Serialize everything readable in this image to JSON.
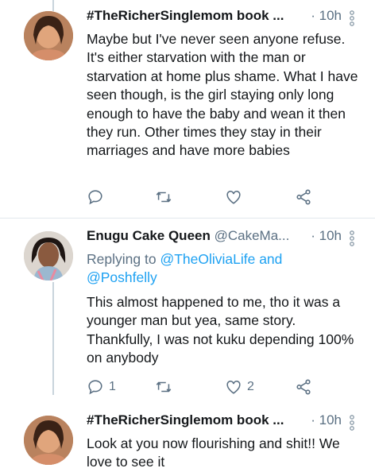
{
  "tweets": [
    {
      "name": "#TheRicherSinglemom book ...",
      "handle": "",
      "time": "· 10h",
      "replying_prefix": "",
      "replying_link1": "",
      "replying_and": "",
      "replying_link2": "",
      "body": "Maybe but I've never seen anyone refuse. It's either starvation with the man or starvation at home plus shame. What I have seen though, is the girl staying only long enough to have the baby and wean it then they run. Other times they stay in their marriages and have more babies",
      "reply_count": "",
      "retweet_count": "",
      "like_count": ""
    },
    {
      "name": "Enugu Cake Queen",
      "handle": "@CakeMa...",
      "time": "· 10h",
      "replying_prefix": "Replying to",
      "replying_link1": "@TheOliviaLife and",
      "replying_link2": "@Poshfelly",
      "body": "This almost happened to me, tho it was a younger man but yea, same story. Thankfully, I was not kuku depending 100% on anybody",
      "reply_count": "1",
      "retweet_count": "",
      "like_count": "2"
    },
    {
      "name": "#TheRicherSinglemom book ...",
      "handle": "",
      "time": "· 10h",
      "body": "Look at you now flourishing and shit!! We love to see it"
    }
  ],
  "icons": {
    "reply": "reply-icon",
    "retweet": "retweet-icon",
    "like": "heart-icon",
    "share": "share-icon",
    "more": "more-vertical-icon"
  },
  "colors": {
    "icon": "#5b7083",
    "link": "#1da1f2",
    "thread_line": "#c9d4dc"
  }
}
